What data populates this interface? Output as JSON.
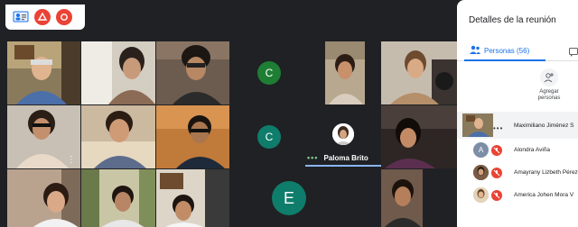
{
  "panel": {
    "title": "Detalles de la reunión",
    "tabs": {
      "people_label": "Personas (56)"
    },
    "add_people_label": "Agregar personas",
    "participants": [
      {
        "name": "Maximiliano Jiménez S",
        "avatar": "video"
      },
      {
        "name": "Alondra Aviña",
        "avatar_letter": "A"
      },
      {
        "name": "Amayrany Lizbeth Pérez",
        "avatar": "photo"
      },
      {
        "name": "America Johen Mora V",
        "avatar": "photo"
      }
    ]
  },
  "tiles": {
    "avatar_c1": "C",
    "avatar_c2": "C",
    "avatar_e": "E",
    "speaker_name": "Paloma Brito"
  },
  "colors": {
    "background": "#202124",
    "avatar_green": "#1e7e34",
    "avatar_teal": "#0f7d6b",
    "accent_blue": "#1a73e8",
    "mute_red": "#ea4335",
    "speaking_blue": "#8ab4f8"
  },
  "icons": [
    "people-icon",
    "chat-icon",
    "add-person-icon",
    "mic-off-icon",
    "more-dots-icon",
    "raise-hand-icon",
    "present-icon"
  ]
}
